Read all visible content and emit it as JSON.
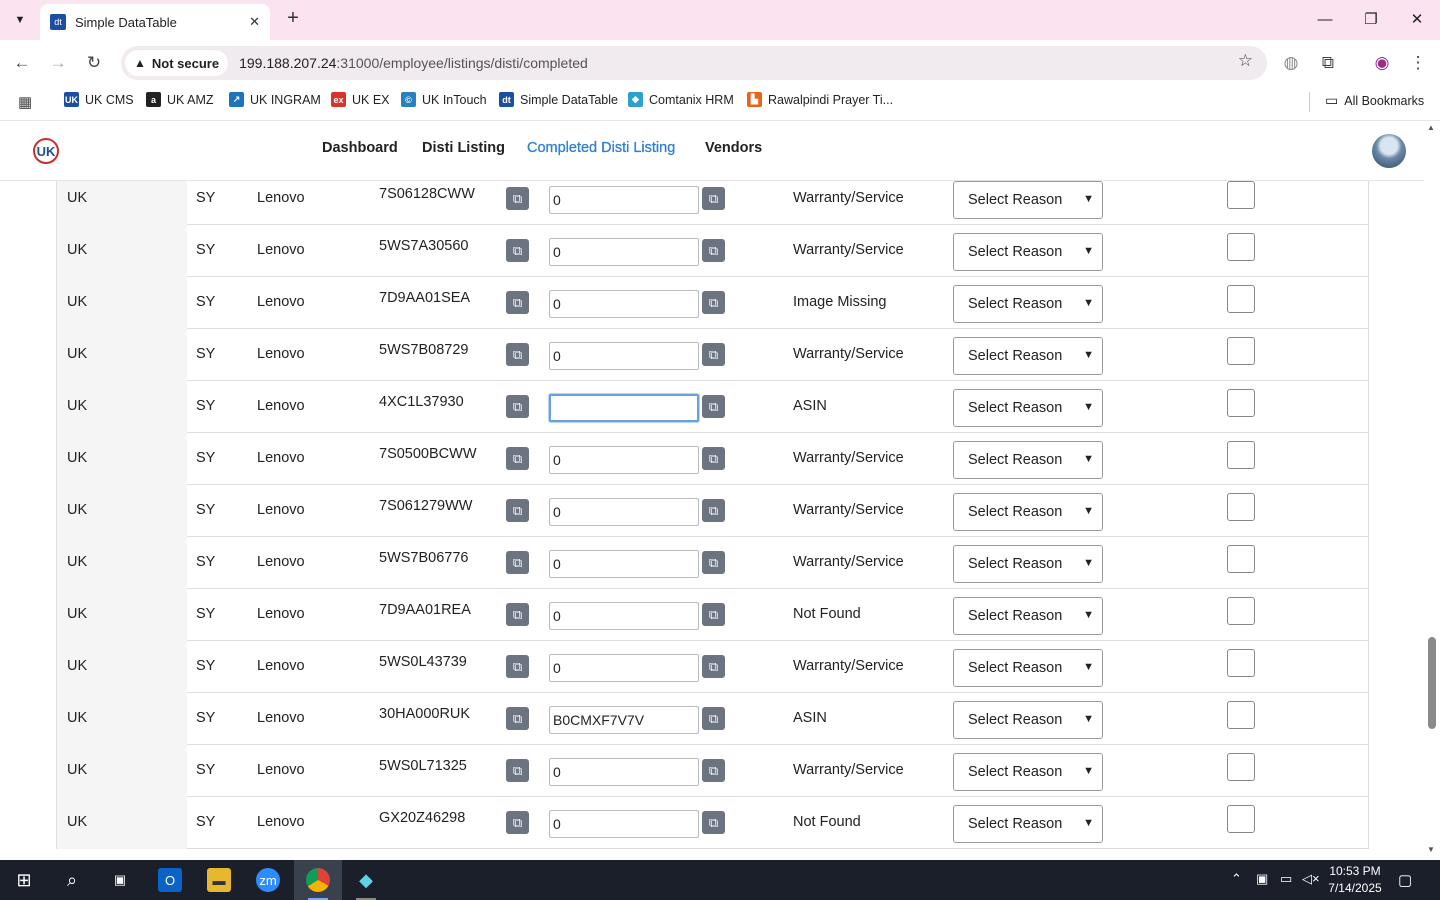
{
  "browser": {
    "tab_title": "Simple DataTable",
    "tab_favicon": "dt",
    "security_label": "Not secure",
    "url_host": "199.188.207.24",
    "url_path": ":31000/employee/listings/disti/completed",
    "bookmarks": [
      {
        "label": "UK CMS",
        "icon": "UK",
        "color": "#1a4fa3"
      },
      {
        "label": "UK AMZ",
        "icon": "a",
        "color": "#222222"
      },
      {
        "label": "UK INGRAM",
        "icon": "↗",
        "color": "#1e73be"
      },
      {
        "label": "UK EX",
        "icon": "ex",
        "color": "#d9342b"
      },
      {
        "label": "UK InTouch",
        "icon": "©",
        "color": "#2a7fbf"
      },
      {
        "label": "Simple DataTable",
        "icon": "dt",
        "color": "#1a4fa3"
      },
      {
        "label": "Comtanix HRM",
        "icon": "◆",
        "color": "#2e9fcf"
      },
      {
        "label": "Rawalpindi Prayer Ti...",
        "icon": "▙",
        "color": "#e8631c"
      }
    ],
    "all_bookmarks": "All Bookmarks"
  },
  "app": {
    "logo_text": "UK",
    "nav": [
      "Dashboard",
      "Disti Listing",
      "Completed Disti Listing",
      "Vendors"
    ],
    "active_nav": "Completed Disti Listing"
  },
  "table": {
    "reason_placeholder": "Select Reason",
    "rows": [
      {
        "country": "UK",
        "code": "SY",
        "brand": "Lenovo",
        "sku": "7S06128CWW",
        "asin": "0",
        "status": "Warranty/Service"
      },
      {
        "country": "UK",
        "code": "SY",
        "brand": "Lenovo",
        "sku": "5WS7A30560",
        "asin": "0",
        "status": "Warranty/Service"
      },
      {
        "country": "UK",
        "code": "SY",
        "brand": "Lenovo",
        "sku": "7D9AA01SEA",
        "asin": "0",
        "status": "Image Missing"
      },
      {
        "country": "UK",
        "code": "SY",
        "brand": "Lenovo",
        "sku": "5WS7B08729",
        "asin": "0",
        "status": "Warranty/Service"
      },
      {
        "country": "UK",
        "code": "SY",
        "brand": "Lenovo",
        "sku": "4XC1L37930",
        "asin": "",
        "status": "ASIN"
      },
      {
        "country": "UK",
        "code": "SY",
        "brand": "Lenovo",
        "sku": "7S0500BCWW",
        "asin": "0",
        "status": "Warranty/Service"
      },
      {
        "country": "UK",
        "code": "SY",
        "brand": "Lenovo",
        "sku": "7S061279WW",
        "asin": "0",
        "status": "Warranty/Service"
      },
      {
        "country": "UK",
        "code": "SY",
        "brand": "Lenovo",
        "sku": "5WS7B06776",
        "asin": "0",
        "status": "Warranty/Service"
      },
      {
        "country": "UK",
        "code": "SY",
        "brand": "Lenovo",
        "sku": "7D9AA01REA",
        "asin": "0",
        "status": "Not Found"
      },
      {
        "country": "UK",
        "code": "SY",
        "brand": "Lenovo",
        "sku": "5WS0L43739",
        "asin": "0",
        "status": "Warranty/Service"
      },
      {
        "country": "UK",
        "code": "SY",
        "brand": "Lenovo",
        "sku": "30HA000RUK",
        "asin": "B0CMXF7V7V",
        "status": "ASIN"
      },
      {
        "country": "UK",
        "code": "SY",
        "brand": "Lenovo",
        "sku": "5WS0L71325",
        "asin": "0",
        "status": "Warranty/Service"
      },
      {
        "country": "UK",
        "code": "SY",
        "brand": "Lenovo",
        "sku": "GX20Z46298",
        "asin": "0",
        "status": "Not Found"
      }
    ],
    "focused_row": 4
  },
  "taskbar": {
    "time": "10:53 PM",
    "date": "7/14/2025"
  }
}
